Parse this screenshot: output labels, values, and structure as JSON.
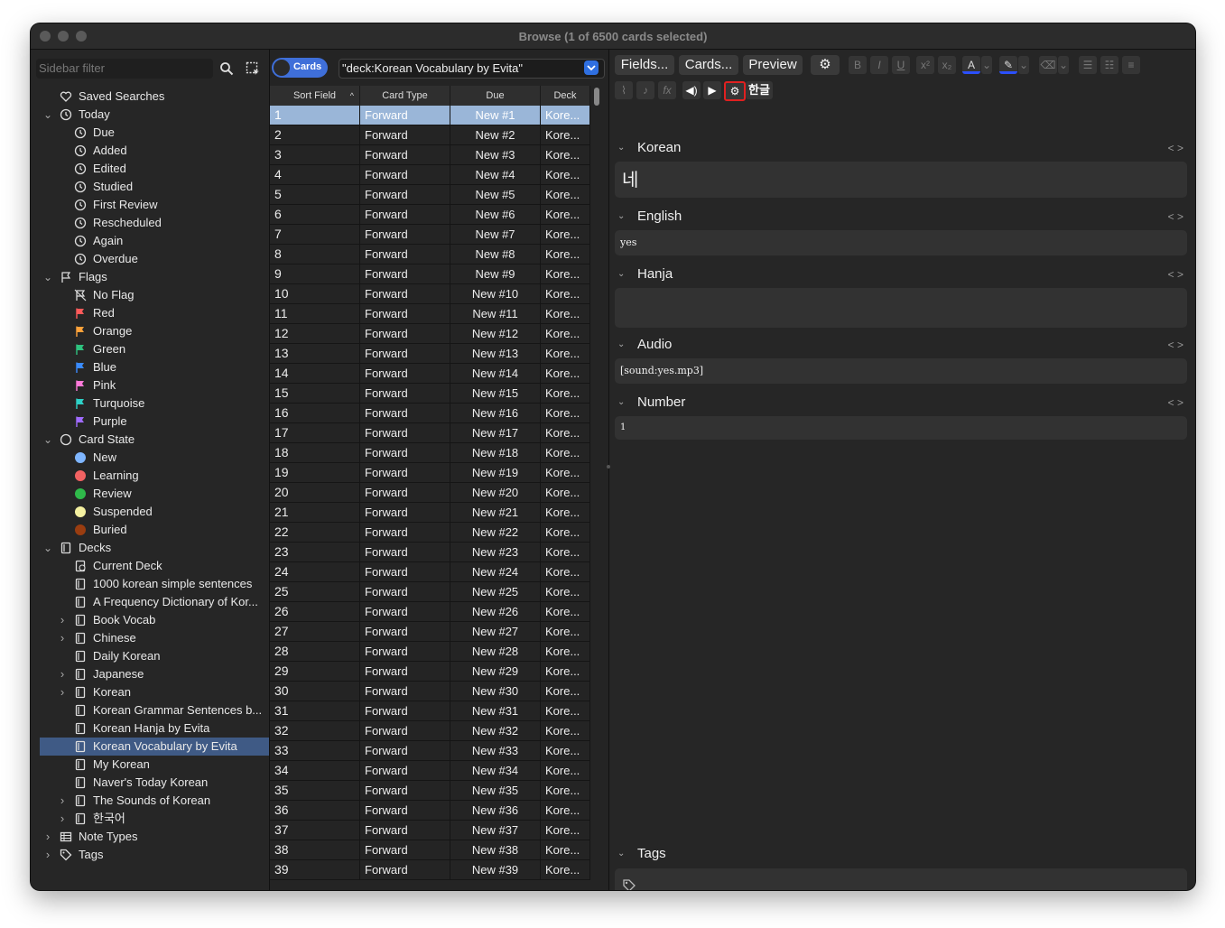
{
  "window": {
    "title": "Browse (1 of 6500 cards selected)"
  },
  "sidebar": {
    "filter_placeholder": "Sidebar filter",
    "items": [
      {
        "label": "Saved Searches",
        "level": 0,
        "icon": "heart-icon",
        "chev": ""
      },
      {
        "label": "Today",
        "level": 0,
        "icon": "clock-icon",
        "chev": "v"
      },
      {
        "label": "Due",
        "level": 1,
        "icon": "clock-icon"
      },
      {
        "label": "Added",
        "level": 1,
        "icon": "clock-icon"
      },
      {
        "label": "Edited",
        "level": 1,
        "icon": "clock-icon"
      },
      {
        "label": "Studied",
        "level": 1,
        "icon": "clock-icon"
      },
      {
        "label": "First Review",
        "level": 1,
        "icon": "clock-icon"
      },
      {
        "label": "Rescheduled",
        "level": 1,
        "icon": "clock-icon"
      },
      {
        "label": "Again",
        "level": 1,
        "icon": "clock-icon"
      },
      {
        "label": "Overdue",
        "level": 1,
        "icon": "clock-icon"
      },
      {
        "label": "Flags",
        "level": 0,
        "icon": "flag-icon",
        "chev": "v"
      },
      {
        "label": "No Flag",
        "level": 1,
        "icon": "no-flag-icon"
      },
      {
        "label": "Red",
        "level": 1,
        "icon": "flag-icon",
        "color": "#ff5a5a"
      },
      {
        "label": "Orange",
        "level": 1,
        "icon": "flag-icon",
        "color": "#ffa23a"
      },
      {
        "label": "Green",
        "level": 1,
        "icon": "flag-icon",
        "color": "#2ec27e"
      },
      {
        "label": "Blue",
        "level": 1,
        "icon": "flag-icon",
        "color": "#3a8bff"
      },
      {
        "label": "Pink",
        "level": 1,
        "icon": "flag-icon",
        "color": "#ff7ad9"
      },
      {
        "label": "Turquoise",
        "level": 1,
        "icon": "flag-icon",
        "color": "#2ed1c7"
      },
      {
        "label": "Purple",
        "level": 1,
        "icon": "flag-icon",
        "color": "#a06bff"
      },
      {
        "label": "Card State",
        "level": 0,
        "icon": "circle-icon",
        "chev": "v"
      },
      {
        "label": "New",
        "level": 1,
        "icon": "dot-icon",
        "color": "#7fb6ff"
      },
      {
        "label": "Learning",
        "level": 1,
        "icon": "dot-icon",
        "color": "#f26262"
      },
      {
        "label": "Review",
        "level": 1,
        "icon": "dot-icon",
        "color": "#2fb94a"
      },
      {
        "label": "Suspended",
        "level": 1,
        "icon": "dot-icon",
        "color": "#f4f0a0"
      },
      {
        "label": "Buried",
        "level": 1,
        "icon": "dot-icon",
        "color": "#9a3d10"
      },
      {
        "label": "Decks",
        "level": 0,
        "icon": "deck-icon",
        "chev": "v"
      },
      {
        "label": "Current Deck",
        "level": 1,
        "icon": "current-deck-icon"
      },
      {
        "label": "1000 korean simple sentences",
        "level": 1,
        "icon": "deck-icon"
      },
      {
        "label": "A Frequency Dictionary of Kor...",
        "level": 1,
        "icon": "deck-icon"
      },
      {
        "label": "Book Vocab",
        "level": 1,
        "icon": "deck-icon",
        "chev": ">"
      },
      {
        "label": "Chinese",
        "level": 1,
        "icon": "deck-icon",
        "chev": ">"
      },
      {
        "label": "Daily Korean",
        "level": 1,
        "icon": "deck-icon"
      },
      {
        "label": "Japanese",
        "level": 1,
        "icon": "deck-icon",
        "chev": ">"
      },
      {
        "label": "Korean",
        "level": 1,
        "icon": "deck-icon",
        "chev": ">"
      },
      {
        "label": "Korean Grammar Sentences b...",
        "level": 1,
        "icon": "deck-icon"
      },
      {
        "label": "Korean Hanja by Evita",
        "level": 1,
        "icon": "deck-icon"
      },
      {
        "label": "Korean Vocabulary by Evita",
        "level": 1,
        "icon": "deck-icon",
        "selected": true
      },
      {
        "label": "My Korean",
        "level": 1,
        "icon": "deck-icon"
      },
      {
        "label": "Naver's Today Korean",
        "level": 1,
        "icon": "deck-icon"
      },
      {
        "label": "The Sounds of Korean",
        "level": 1,
        "icon": "deck-icon",
        "chev": ">"
      },
      {
        "label": "한국어",
        "level": 1,
        "icon": "deck-icon",
        "chev": ">"
      },
      {
        "label": "Note Types",
        "level": 0,
        "icon": "note-types-icon",
        "chev": ">"
      },
      {
        "label": "Tags",
        "level": 0,
        "icon": "tag-icon",
        "chev": ">"
      }
    ]
  },
  "list": {
    "toggle_label": "Cards",
    "search_value": "\"deck:Korean Vocabulary by Evita\"",
    "columns": [
      "Sort Field",
      "Card Type",
      "Due",
      "Deck"
    ],
    "rows": [
      [
        "1",
        "Forward",
        "New #1",
        "Kore..."
      ],
      [
        "2",
        "Forward",
        "New #2",
        "Kore..."
      ],
      [
        "3",
        "Forward",
        "New #3",
        "Kore..."
      ],
      [
        "4",
        "Forward",
        "New #4",
        "Kore..."
      ],
      [
        "5",
        "Forward",
        "New #5",
        "Kore..."
      ],
      [
        "6",
        "Forward",
        "New #6",
        "Kore..."
      ],
      [
        "7",
        "Forward",
        "New #7",
        "Kore..."
      ],
      [
        "8",
        "Forward",
        "New #8",
        "Kore..."
      ],
      [
        "9",
        "Forward",
        "New #9",
        "Kore..."
      ],
      [
        "10",
        "Forward",
        "New #10",
        "Kore..."
      ],
      [
        "11",
        "Forward",
        "New #11",
        "Kore..."
      ],
      [
        "12",
        "Forward",
        "New #12",
        "Kore..."
      ],
      [
        "13",
        "Forward",
        "New #13",
        "Kore..."
      ],
      [
        "14",
        "Forward",
        "New #14",
        "Kore..."
      ],
      [
        "15",
        "Forward",
        "New #15",
        "Kore..."
      ],
      [
        "16",
        "Forward",
        "New #16",
        "Kore..."
      ],
      [
        "17",
        "Forward",
        "New #17",
        "Kore..."
      ],
      [
        "18",
        "Forward",
        "New #18",
        "Kore..."
      ],
      [
        "19",
        "Forward",
        "New #19",
        "Kore..."
      ],
      [
        "20",
        "Forward",
        "New #20",
        "Kore..."
      ],
      [
        "21",
        "Forward",
        "New #21",
        "Kore..."
      ],
      [
        "22",
        "Forward",
        "New #22",
        "Kore..."
      ],
      [
        "23",
        "Forward",
        "New #23",
        "Kore..."
      ],
      [
        "24",
        "Forward",
        "New #24",
        "Kore..."
      ],
      [
        "25",
        "Forward",
        "New #25",
        "Kore..."
      ],
      [
        "26",
        "Forward",
        "New #26",
        "Kore..."
      ],
      [
        "27",
        "Forward",
        "New #27",
        "Kore..."
      ],
      [
        "28",
        "Forward",
        "New #28",
        "Kore..."
      ],
      [
        "29",
        "Forward",
        "New #29",
        "Kore..."
      ],
      [
        "30",
        "Forward",
        "New #30",
        "Kore..."
      ],
      [
        "31",
        "Forward",
        "New #31",
        "Kore..."
      ],
      [
        "32",
        "Forward",
        "New #32",
        "Kore..."
      ],
      [
        "33",
        "Forward",
        "New #33",
        "Kore..."
      ],
      [
        "34",
        "Forward",
        "New #34",
        "Kore..."
      ],
      [
        "35",
        "Forward",
        "New #35",
        "Kore..."
      ],
      [
        "36",
        "Forward",
        "New #36",
        "Kore..."
      ],
      [
        "37",
        "Forward",
        "New #37",
        "Kore..."
      ],
      [
        "38",
        "Forward",
        "New #38",
        "Kore..."
      ],
      [
        "39",
        "Forward",
        "New #39",
        "Kore..."
      ]
    ]
  },
  "editor": {
    "buttons": {
      "fields": "Fields...",
      "cards": "Cards...",
      "preview": "Preview",
      "hangul": "한글"
    },
    "fields": [
      {
        "name": "Korean",
        "value": "네"
      },
      {
        "name": "English",
        "value": "yes"
      },
      {
        "name": "Hanja",
        "value": ""
      },
      {
        "name": "Audio",
        "value": "[sound:yes.mp3]"
      },
      {
        "name": "Number",
        "value": "1"
      }
    ],
    "tags_label": "Tags"
  }
}
